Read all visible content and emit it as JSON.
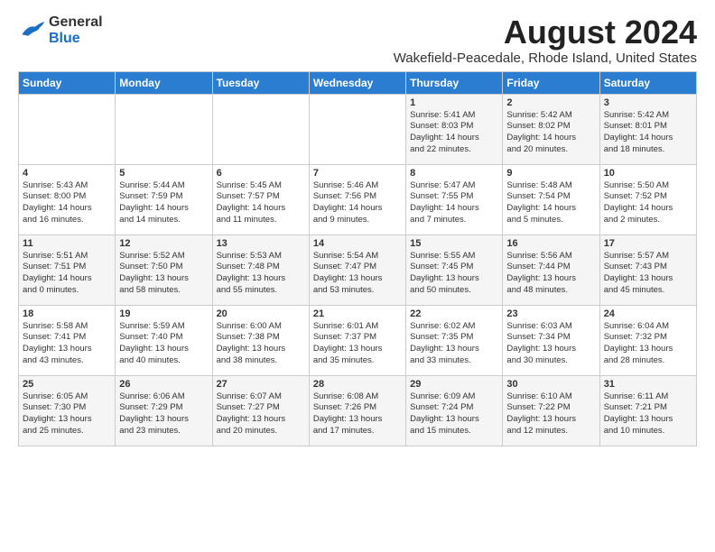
{
  "logo": {
    "general": "General",
    "blue": "Blue"
  },
  "title": "August 2024",
  "subtitle": "Wakefield-Peacedale, Rhode Island, United States",
  "days_of_week": [
    "Sunday",
    "Monday",
    "Tuesday",
    "Wednesday",
    "Thursday",
    "Friday",
    "Saturday"
  ],
  "weeks": [
    [
      {
        "day": "",
        "content": ""
      },
      {
        "day": "",
        "content": ""
      },
      {
        "day": "",
        "content": ""
      },
      {
        "day": "",
        "content": ""
      },
      {
        "day": "1",
        "content": "Sunrise: 5:41 AM\nSunset: 8:03 PM\nDaylight: 14 hours\nand 22 minutes."
      },
      {
        "day": "2",
        "content": "Sunrise: 5:42 AM\nSunset: 8:02 PM\nDaylight: 14 hours\nand 20 minutes."
      },
      {
        "day": "3",
        "content": "Sunrise: 5:42 AM\nSunset: 8:01 PM\nDaylight: 14 hours\nand 18 minutes."
      }
    ],
    [
      {
        "day": "4",
        "content": "Sunrise: 5:43 AM\nSunset: 8:00 PM\nDaylight: 14 hours\nand 16 minutes."
      },
      {
        "day": "5",
        "content": "Sunrise: 5:44 AM\nSunset: 7:59 PM\nDaylight: 14 hours\nand 14 minutes."
      },
      {
        "day": "6",
        "content": "Sunrise: 5:45 AM\nSunset: 7:57 PM\nDaylight: 14 hours\nand 11 minutes."
      },
      {
        "day": "7",
        "content": "Sunrise: 5:46 AM\nSunset: 7:56 PM\nDaylight: 14 hours\nand 9 minutes."
      },
      {
        "day": "8",
        "content": "Sunrise: 5:47 AM\nSunset: 7:55 PM\nDaylight: 14 hours\nand 7 minutes."
      },
      {
        "day": "9",
        "content": "Sunrise: 5:48 AM\nSunset: 7:54 PM\nDaylight: 14 hours\nand 5 minutes."
      },
      {
        "day": "10",
        "content": "Sunrise: 5:50 AM\nSunset: 7:52 PM\nDaylight: 14 hours\nand 2 minutes."
      }
    ],
    [
      {
        "day": "11",
        "content": "Sunrise: 5:51 AM\nSunset: 7:51 PM\nDaylight: 14 hours\nand 0 minutes."
      },
      {
        "day": "12",
        "content": "Sunrise: 5:52 AM\nSunset: 7:50 PM\nDaylight: 13 hours\nand 58 minutes."
      },
      {
        "day": "13",
        "content": "Sunrise: 5:53 AM\nSunset: 7:48 PM\nDaylight: 13 hours\nand 55 minutes."
      },
      {
        "day": "14",
        "content": "Sunrise: 5:54 AM\nSunset: 7:47 PM\nDaylight: 13 hours\nand 53 minutes."
      },
      {
        "day": "15",
        "content": "Sunrise: 5:55 AM\nSunset: 7:45 PM\nDaylight: 13 hours\nand 50 minutes."
      },
      {
        "day": "16",
        "content": "Sunrise: 5:56 AM\nSunset: 7:44 PM\nDaylight: 13 hours\nand 48 minutes."
      },
      {
        "day": "17",
        "content": "Sunrise: 5:57 AM\nSunset: 7:43 PM\nDaylight: 13 hours\nand 45 minutes."
      }
    ],
    [
      {
        "day": "18",
        "content": "Sunrise: 5:58 AM\nSunset: 7:41 PM\nDaylight: 13 hours\nand 43 minutes."
      },
      {
        "day": "19",
        "content": "Sunrise: 5:59 AM\nSunset: 7:40 PM\nDaylight: 13 hours\nand 40 minutes."
      },
      {
        "day": "20",
        "content": "Sunrise: 6:00 AM\nSunset: 7:38 PM\nDaylight: 13 hours\nand 38 minutes."
      },
      {
        "day": "21",
        "content": "Sunrise: 6:01 AM\nSunset: 7:37 PM\nDaylight: 13 hours\nand 35 minutes."
      },
      {
        "day": "22",
        "content": "Sunrise: 6:02 AM\nSunset: 7:35 PM\nDaylight: 13 hours\nand 33 minutes."
      },
      {
        "day": "23",
        "content": "Sunrise: 6:03 AM\nSunset: 7:34 PM\nDaylight: 13 hours\nand 30 minutes."
      },
      {
        "day": "24",
        "content": "Sunrise: 6:04 AM\nSunset: 7:32 PM\nDaylight: 13 hours\nand 28 minutes."
      }
    ],
    [
      {
        "day": "25",
        "content": "Sunrise: 6:05 AM\nSunset: 7:30 PM\nDaylight: 13 hours\nand 25 minutes."
      },
      {
        "day": "26",
        "content": "Sunrise: 6:06 AM\nSunset: 7:29 PM\nDaylight: 13 hours\nand 23 minutes."
      },
      {
        "day": "27",
        "content": "Sunrise: 6:07 AM\nSunset: 7:27 PM\nDaylight: 13 hours\nand 20 minutes."
      },
      {
        "day": "28",
        "content": "Sunrise: 6:08 AM\nSunset: 7:26 PM\nDaylight: 13 hours\nand 17 minutes."
      },
      {
        "day": "29",
        "content": "Sunrise: 6:09 AM\nSunset: 7:24 PM\nDaylight: 13 hours\nand 15 minutes."
      },
      {
        "day": "30",
        "content": "Sunrise: 6:10 AM\nSunset: 7:22 PM\nDaylight: 13 hours\nand 12 minutes."
      },
      {
        "day": "31",
        "content": "Sunrise: 6:11 AM\nSunset: 7:21 PM\nDaylight: 13 hours\nand 10 minutes."
      }
    ]
  ]
}
